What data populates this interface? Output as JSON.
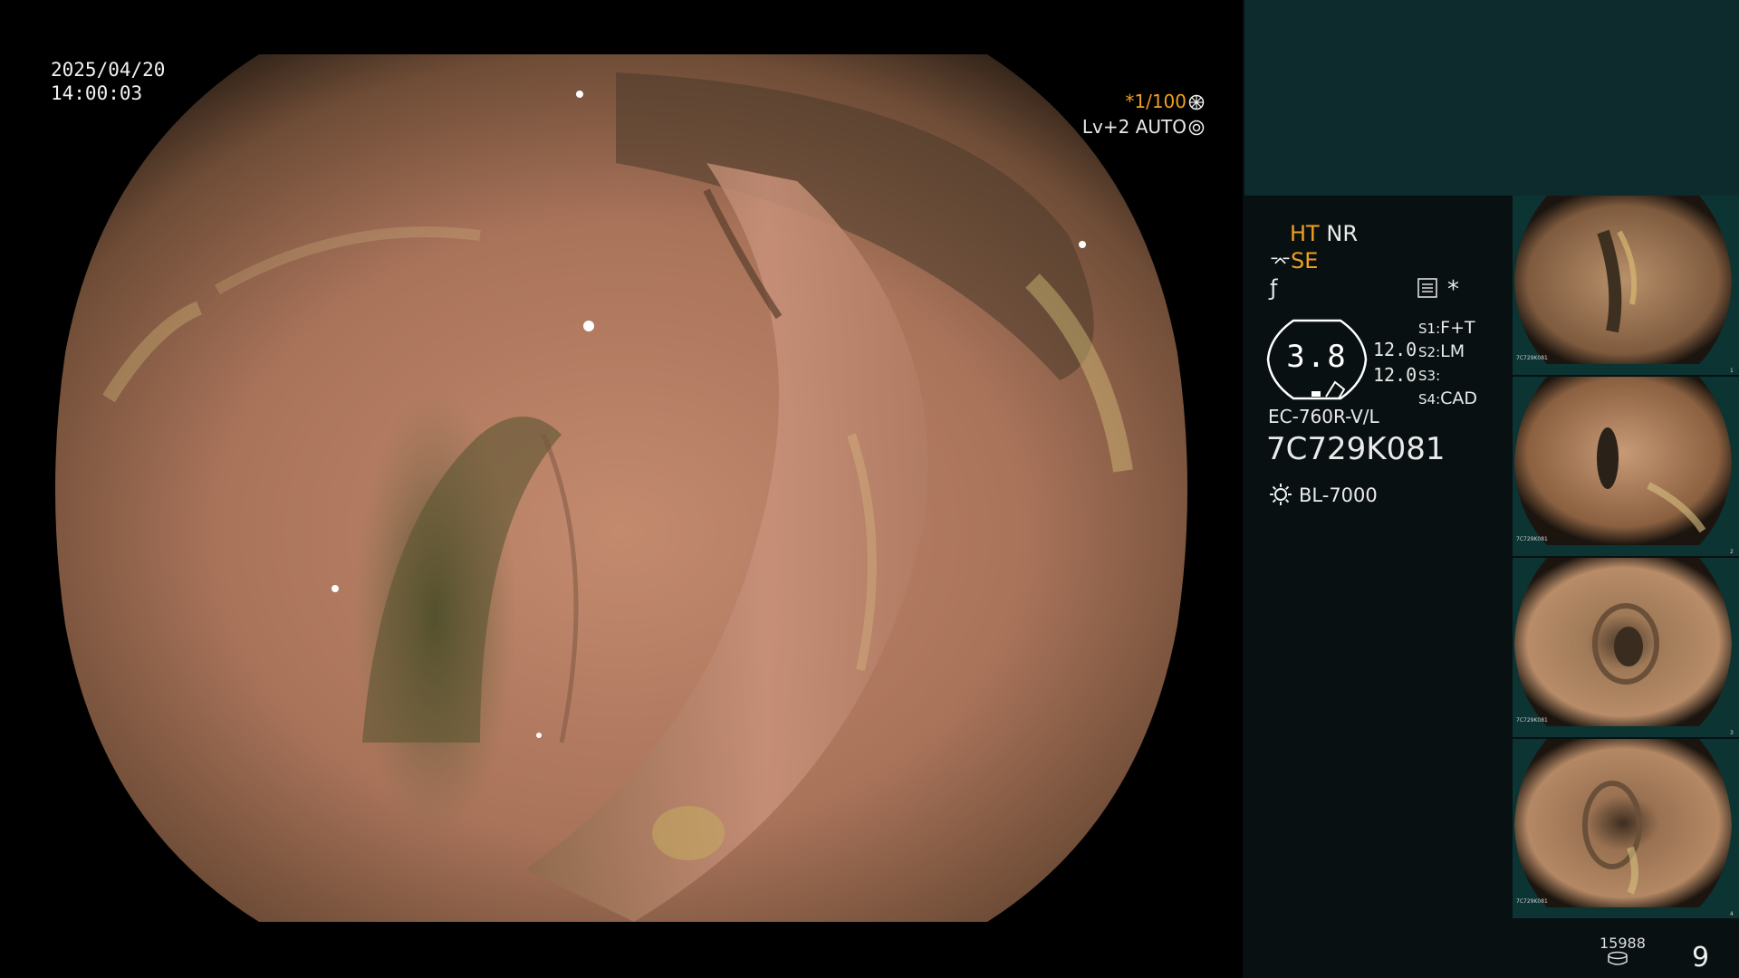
{
  "main": {
    "date": "2025/04/20",
    "time": "14:00:03",
    "shutter": "*1/100",
    "iris": "Lv+2 AUTO"
  },
  "panel": {
    "ht": "HT",
    "nr": "NR",
    "se": "SE",
    "zoom": "3.8",
    "level_top": "12.0",
    "level_bottom": "12.0",
    "s1_label": "S1",
    "s1_value": "F+T",
    "s2_label": "S2",
    "s2_value": "LM",
    "s3_label": "S3",
    "s3_value": "",
    "s4_label": "S4",
    "s4_value": "CAD",
    "scope_model": "EC-760R-V/L",
    "scope_serial": "7C729K081",
    "light_source": "BL-7000"
  },
  "thumbnails": [
    {
      "serial": "7C729K081",
      "index": "1"
    },
    {
      "serial": "7C729K081",
      "index": "2"
    },
    {
      "serial": "7C729K081",
      "index": "3"
    },
    {
      "serial": "7C729K081",
      "index": "4"
    }
  ],
  "footer": {
    "counter": "15988",
    "page": "9"
  },
  "colors": {
    "accent": "#f0a020",
    "panel_top": "#0d2b2c",
    "panel_bg": "#081012"
  },
  "icons": [
    "shutter-icon",
    "iris-icon",
    "enhance-icon",
    "freeze-icon",
    "menu-icon",
    "star-icon",
    "light-source-icon",
    "disk-icon"
  ]
}
